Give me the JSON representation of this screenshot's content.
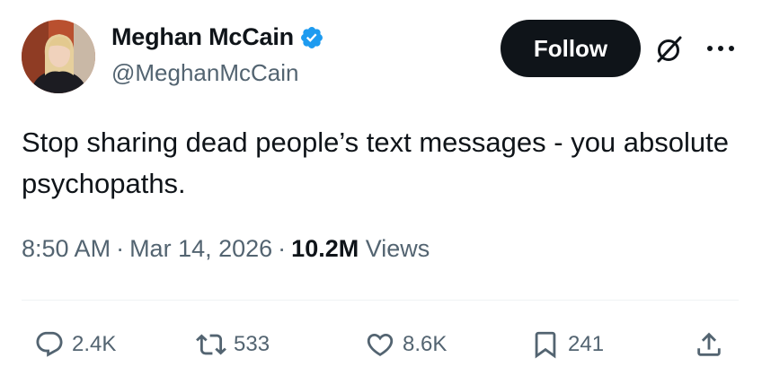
{
  "user": {
    "display_name": "Meghan McCain",
    "handle": "@MeghanMcCain",
    "verified_color": "#1d9bf0"
  },
  "header": {
    "follow_label": "Follow",
    "icons": [
      "grok-icon",
      "more-icon"
    ]
  },
  "tweet": {
    "text": "Stop sharing dead people’s text messages - you absolute psychopaths."
  },
  "meta": {
    "time": "8:50 AM",
    "separator": "·",
    "date": "Mar 14, 2026",
    "views_count": "10.2M",
    "views_label": "Views"
  },
  "actions": {
    "replies": "2.4K",
    "reposts": "533",
    "likes": "8.6K",
    "bookmarks": "241"
  },
  "colors": {
    "text": "#0f1419",
    "secondary": "#536471",
    "follow_bg": "#0f1419",
    "divider": "#eff3f4"
  }
}
